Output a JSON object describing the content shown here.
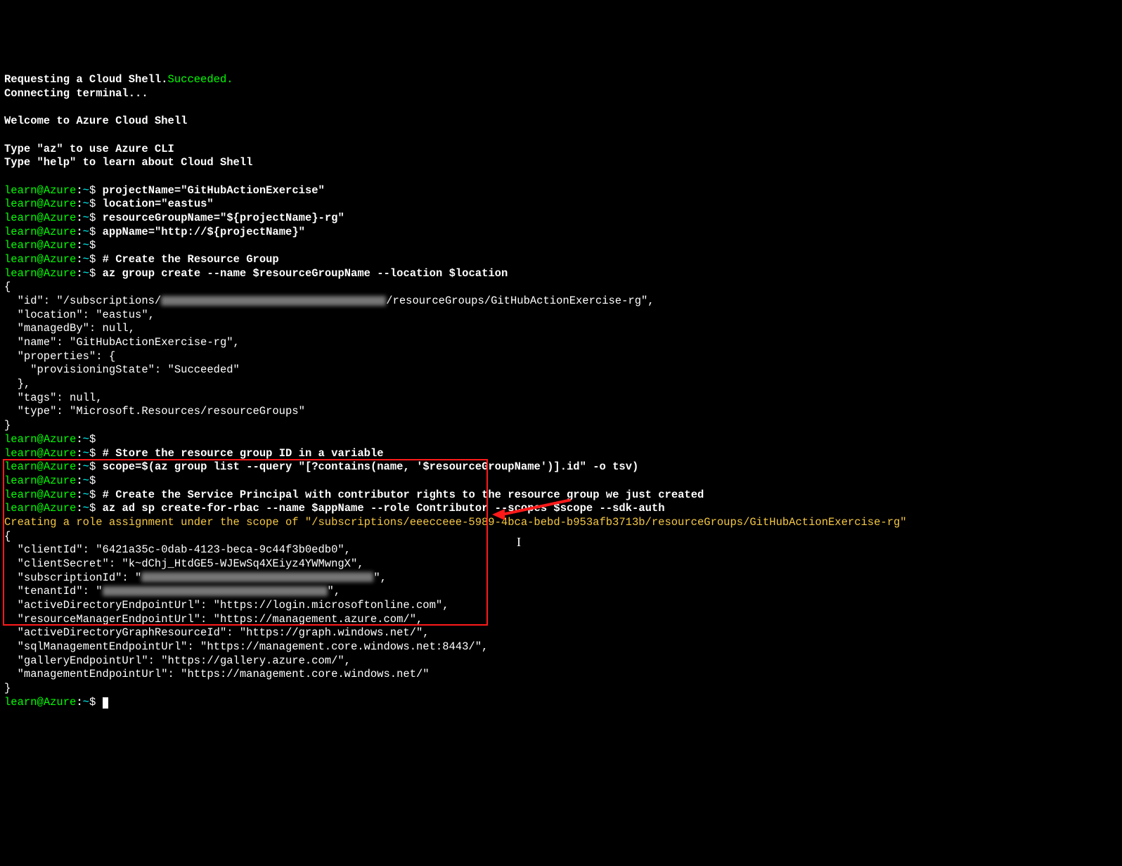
{
  "intro": {
    "req": "Requesting a Cloud Shell.",
    "succeeded": "Succeeded.",
    "connecting": "Connecting terminal...",
    "welcome": "Welcome to Azure Cloud Shell",
    "typeaz": "Type \"az\" to use Azure CLI",
    "typehelp": "Type \"help\" to learn about Cloud Shell"
  },
  "prompt": {
    "user": "learn",
    "at": "@",
    "host": "Azure",
    "colon": ":",
    "path": "~",
    "dollar": "$"
  },
  "cmds": {
    "c1": "projectName=\"GitHubActionExercise\"",
    "c2": "location=\"eastus\"",
    "c3": "resourceGroupName=\"${projectName}-rg\"",
    "c4": "appName=\"http://${projectName}\"",
    "c5": "",
    "c6": "# Create the Resource Group",
    "c7": "az group create --name $resourceGroupName --location $location",
    "c8": "",
    "c9": "# Store the resource group ID in a variable",
    "c10": "scope=$(az group list --query \"[?contains(name, '$resourceGroupName')].id\" -o tsv)",
    "c11": "",
    "c12": "# Create the Service Principal with contributor rights to the resource group we just created",
    "c13": "az ad sp create-for-rbac --name $appName --role Contributor --scopes $scope --sdk-auth"
  },
  "out1": {
    "open": "{",
    "id_pre": "  \"id\": \"/subscriptions/",
    "id_post": "/resourceGroups/GitHubActionExercise-rg\",",
    "loc": "  \"location\": \"eastus\",",
    "managed": "  \"managedBy\": null,",
    "name": "  \"name\": \"GitHubActionExercise-rg\",",
    "propsOpen": "  \"properties\": {",
    "prov": "    \"provisioningState\": \"Succeeded\"",
    "propsClose": "  },",
    "tags": "  \"tags\": null,",
    "type": "  \"type\": \"Microsoft.Resources/resourceGroups\"",
    "close": "}"
  },
  "roleMsg": "Creating a role assignment under the scope of \"/subscriptions/eeecceee-5989-4bca-bebd-b953afb3713b/resourceGroups/GitHubActionExercise-rg\"",
  "out2": {
    "open": "{",
    "clientId": "  \"clientId\": \"6421a35c-0dab-4123-beca-9c44f3b0edb0\",",
    "clientSecret": "  \"clientSecret\": \"k~dChj_HtdGE5-WJEwSq4XEiyz4YWMwngX\",",
    "subId_pre": "  \"subscriptionId\": \"",
    "subId_post": "\",",
    "tenantId_pre": "  \"tenantId\": \"",
    "tenantId_post": "\",",
    "ad": "  \"activeDirectoryEndpointUrl\": \"https://login.microsoftonline.com\",",
    "rm": "  \"resourceManagerEndpointUrl\": \"https://management.azure.com/\",",
    "graph": "  \"activeDirectoryGraphResourceId\": \"https://graph.windows.net/\",",
    "sql": "  \"sqlManagementEndpointUrl\": \"https://management.core.windows.net:8443/\",",
    "gallery": "  \"galleryEndpointUrl\": \"https://gallery.azure.com/\",",
    "mgmt": "  \"managementEndpointUrl\": \"https://management.core.windows.net/\"",
    "close": "}"
  }
}
